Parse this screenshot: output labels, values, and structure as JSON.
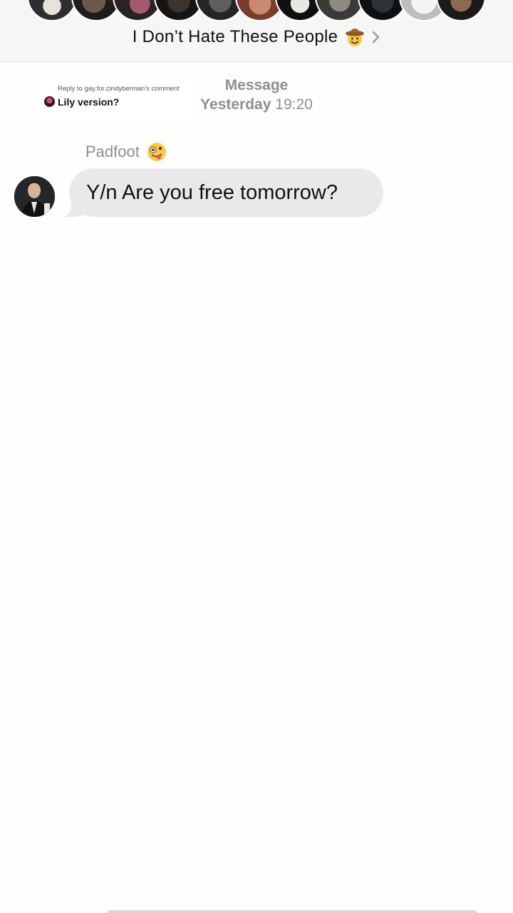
{
  "header": {
    "group_title": "I Don’t Hate These People",
    "title_emoji": "cowboy-hat-face",
    "chevron": "chevron-right-icon"
  },
  "reply": {
    "reply_to": "Reply to gay.for.cindyberman's comment",
    "text": "Lily version?"
  },
  "timestamp": {
    "label": "Message",
    "day": "Yesterday",
    "time": "19:20"
  },
  "message": {
    "sender": "Padfoot",
    "sender_emoji": "zany-face",
    "text": "Y/n Are you free tomorrow?"
  },
  "colors": {
    "bubble_incoming": "#e9e9eb",
    "meta_text": "#8e8e93",
    "background": "#fefefc",
    "header_bg": "#f6f6f6"
  }
}
